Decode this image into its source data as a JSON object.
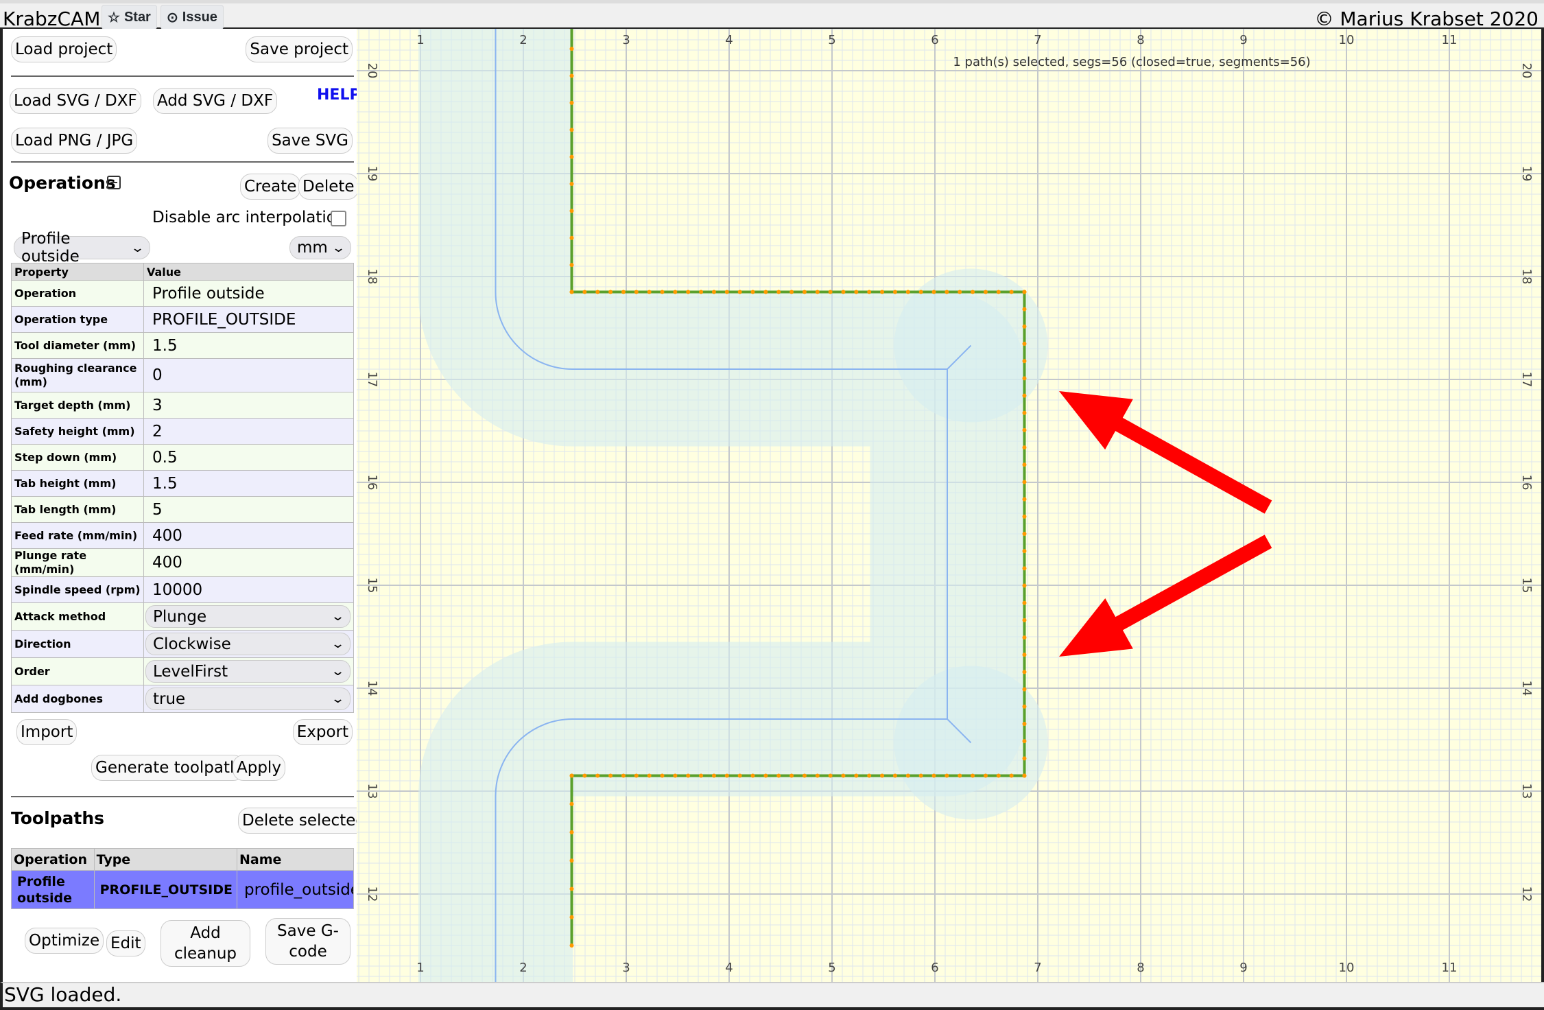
{
  "app": {
    "title": "KrabzCAM",
    "star": "Star",
    "issue": "Issue",
    "copyright": "© Marius Krabset 2020"
  },
  "file": {
    "load_project": "Load project",
    "save_project": "Save project",
    "load_svg": "Load SVG / DXF",
    "add_svg": "Add SVG / DXF",
    "help": "HELP",
    "load_png": "Load PNG / JPG",
    "save_svg": "Save SVG"
  },
  "operations": {
    "heading": "Operations",
    "create": "Create",
    "delete": "Delete",
    "disable_arc": "Disable arc interpolation",
    "disable_arc_checked": false,
    "op_select": "Profile outside",
    "unit_select": "mm",
    "col_property": "Property",
    "col_value": "Value",
    "rows": [
      {
        "k": "Operation",
        "v": "Profile outside"
      },
      {
        "k": "Operation type",
        "v": "PROFILE_OUTSIDE"
      },
      {
        "k": "Tool diameter (mm)",
        "v": "1.5"
      },
      {
        "k": "Roughing clearance (mm)",
        "v": "0"
      },
      {
        "k": "Target depth (mm)",
        "v": "3"
      },
      {
        "k": "Safety height (mm)",
        "v": "2"
      },
      {
        "k": "Step down (mm)",
        "v": "0.5"
      },
      {
        "k": "Tab height (mm)",
        "v": "1.5"
      },
      {
        "k": "Tab length (mm)",
        "v": "5"
      },
      {
        "k": "Feed rate (mm/min)",
        "v": "400"
      },
      {
        "k": "Plunge rate (mm/min)",
        "v": "400"
      },
      {
        "k": "Spindle speed (rpm)",
        "v": "10000"
      }
    ],
    "select_rows": [
      {
        "k": "Attack method",
        "v": "Plunge"
      },
      {
        "k": "Direction",
        "v": "Clockwise"
      },
      {
        "k": "Order",
        "v": "LevelFirst"
      },
      {
        "k": "Add dogbones",
        "v": "true"
      }
    ],
    "import": "Import",
    "export": "Export",
    "generate": "Generate toolpath",
    "apply": "Apply"
  },
  "toolpaths": {
    "heading": "Toolpaths",
    "delete_selected": "Delete selected",
    "cols": [
      "Operation",
      "Type",
      "Name"
    ],
    "rows": [
      {
        "operation": "Profile outside",
        "type": "PROFILE_OUTSIDE",
        "name": "profile_outside"
      }
    ],
    "optimize": "Optimize",
    "edit": "Edit",
    "add_cleanup": "Add cleanup",
    "save_gcode": "Save G-code"
  },
  "canvas": {
    "selection_info": "1 path(s) selected, segs=56 (closed=true, segments=56)",
    "x_ticks": [
      "1",
      "2",
      "3",
      "4",
      "5",
      "6",
      "7",
      "8",
      "9",
      "10",
      "11"
    ],
    "y_ticks": [
      "12",
      "13",
      "14",
      "15",
      "16",
      "17",
      "18",
      "19",
      "20"
    ],
    "colors": {
      "background": "#ffffe0",
      "path": "#5aa02c",
      "vertex": "#ff9900",
      "toolpath": "#8ab4f0",
      "tool_area": "#d6ecf0",
      "annotation_arrow": "#ff0000"
    }
  },
  "status": "SVG loaded."
}
